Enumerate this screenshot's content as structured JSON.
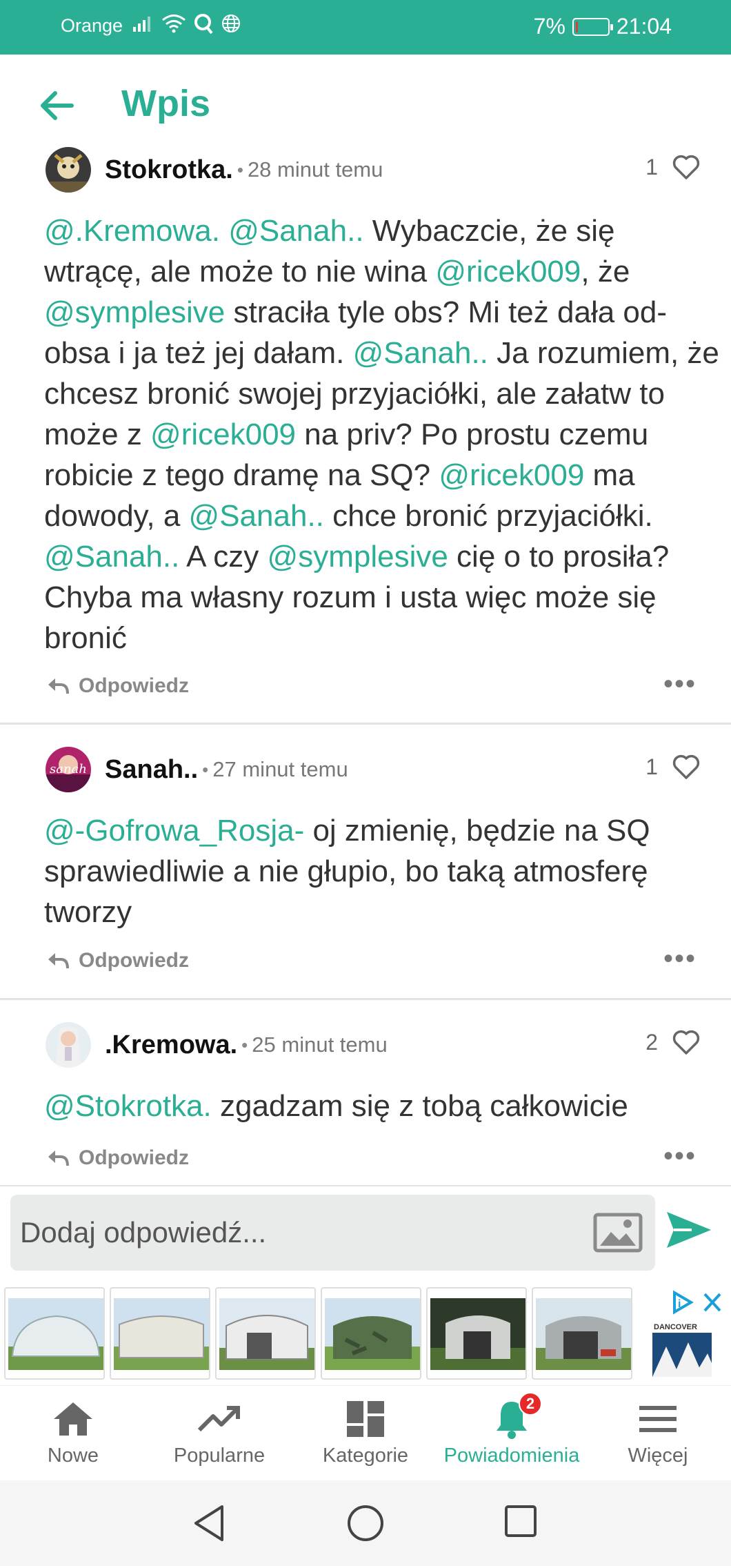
{
  "status_bar": {
    "carrier": "Orange",
    "battery": "7%",
    "battery_level": 0.07,
    "time": "21:04"
  },
  "header": {
    "title": "Wpis"
  },
  "comments": [
    {
      "author": "Stokrotka.",
      "time": "28 minut temu",
      "likes": "1",
      "body": [
        [
          "m",
          "@.Kremowa."
        ],
        [
          "t",
          " "
        ],
        [
          "m",
          "@Sanah.."
        ],
        [
          "t",
          " Wybaczcie, że się wtrącę, ale może to nie wina "
        ],
        [
          "m",
          "@ricek009"
        ],
        [
          "t",
          ", że "
        ],
        [
          "m",
          "@symplesive"
        ],
        [
          "t",
          " straciła tyle obs? Mi też dała od-obsa i ja też jej dałam. "
        ],
        [
          "m",
          "@Sanah.."
        ],
        [
          "t",
          " Ja rozumiem, że chcesz bronić swojej przyjaciółki, ale załatw to może z "
        ],
        [
          "m",
          "@ricek009"
        ],
        [
          "t",
          " na priv? Po prostu czemu robicie z tego dramę na SQ? "
        ],
        [
          "m",
          "@ricek009"
        ],
        [
          "t",
          " ma dowody, a "
        ],
        [
          "m",
          "@Sanah.."
        ],
        [
          "t",
          " chce bronić przyjaciółki. "
        ],
        [
          "m",
          "@Sanah.."
        ],
        [
          "t",
          " A czy "
        ],
        [
          "m",
          "@symplesive"
        ],
        [
          "t",
          " cię o to prosiła? Chyba ma własny rozum i usta więc może się bronić"
        ]
      ],
      "reply_label": "Odpowiedz"
    },
    {
      "author": "Sanah..",
      "time": "27 minut temu",
      "likes": "1",
      "body": [
        [
          "m",
          "@-Gofrowa_Rosja-"
        ],
        [
          "t",
          " oj zmienię, będzie na SQ sprawiedliwie a nie głupio, bo taką atmosferę tworzy"
        ]
      ],
      "reply_label": "Odpowiedz"
    },
    {
      "author": ".Kremowa.",
      "time": "25 minut temu",
      "likes": "2",
      "body": [
        [
          "m",
          "@Stokrotka."
        ],
        [
          "t",
          " zgadzam się z tobą całkowicie"
        ]
      ],
      "reply_label": "Odpowiedz"
    }
  ],
  "compose": {
    "placeholder": "Dodaj odpowiedź..."
  },
  "ad": {
    "brand": "DANCOVER"
  },
  "bottom_nav": [
    {
      "label": "Nowe",
      "icon": "home-icon"
    },
    {
      "label": "Popularne",
      "icon": "trending-icon"
    },
    {
      "label": "Kategorie",
      "icon": "dashboard-icon"
    },
    {
      "label": "Powiadomienia",
      "icon": "bell-icon",
      "badge": "2",
      "active": true
    },
    {
      "label": "Więcej",
      "icon": "menu-icon"
    }
  ],
  "colors": {
    "accent": "#2aae94",
    "mention": "#2aae94",
    "badge": "#e52929",
    "battery_low": "#e23b3b"
  }
}
